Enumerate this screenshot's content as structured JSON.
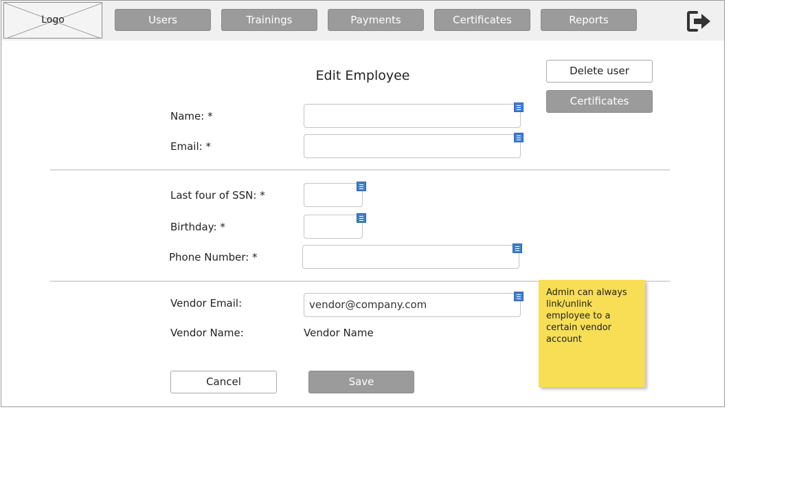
{
  "header": {
    "logo": "Logo",
    "nav": [
      "Users",
      "Trainings",
      "Payments",
      "Certificates",
      "Reports"
    ]
  },
  "page": {
    "title": "Edit Employee",
    "delete_button": "Delete user",
    "certificates_button": "Certificates"
  },
  "form": {
    "name_label": "Name: *",
    "name_value": "",
    "email_label": "Email: *",
    "email_value": "",
    "ssn_label": "Last four of SSN: *",
    "ssn_value": "",
    "birthday_label": "Birthday: *",
    "birthday_value": "",
    "phone_label": "Phone Number: *",
    "phone_value": "",
    "vendor_email_label": "Vendor Email:",
    "vendor_email_value": "vendor@company.com",
    "vendor_name_label": "Vendor Name:",
    "vendor_name_value": "Vendor Name",
    "cancel_button": "Cancel",
    "save_button": "Save"
  },
  "sticky_note": "Admin can always link/unlink employee to a certain vendor account",
  "icons": {
    "logout": "logout-icon",
    "field": "field-list-icon"
  }
}
